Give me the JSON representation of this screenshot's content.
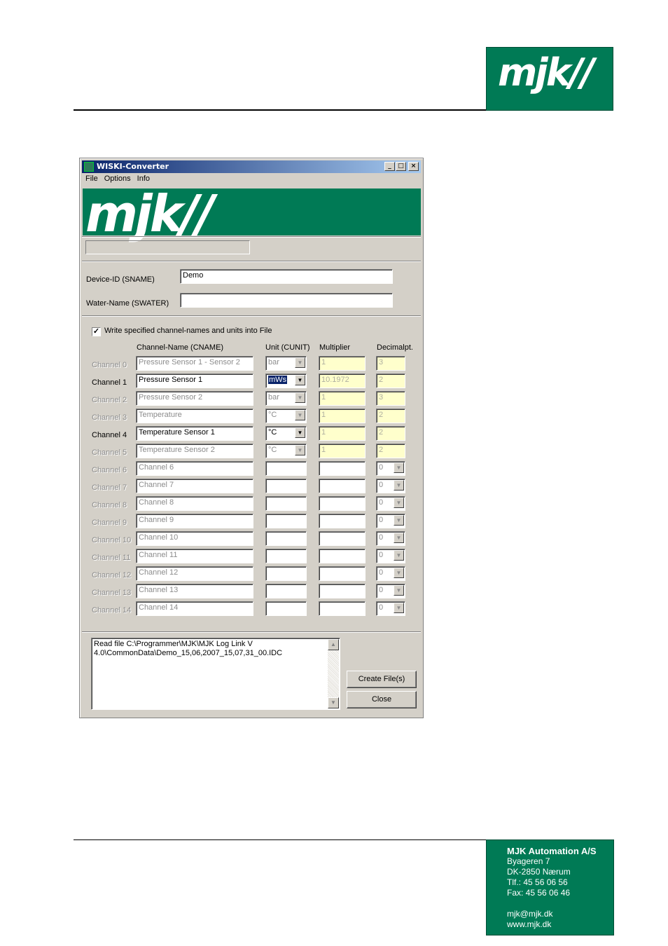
{
  "header": {
    "logo_text": "mjk//",
    "brand_color": "#007a55"
  },
  "window": {
    "title": "WISKI-Converter",
    "controls": {
      "minimize": "_",
      "maximize": "□",
      "close": "×"
    },
    "menu": [
      "File",
      "Options",
      "Info"
    ],
    "banner_logo": "mjk//",
    "device_id_label": "Device-ID (SNAME)",
    "device_id_value": "Demo",
    "water_name_label": "Water-Name (SWATER)",
    "water_name_value": "",
    "write_checkbox_label": "Write specified channel-names and units into File",
    "write_checkbox_checked": true,
    "columns": {
      "name": "Channel-Name (CNAME)",
      "unit": "Unit (CUNIT)",
      "multiplier": "Multiplier",
      "decimal": "Decimalpt."
    },
    "channels": [
      {
        "label": "Channel 0",
        "name": "Pressure Sensor 1 - Sensor 2",
        "unit": "bar",
        "multiplier": "1",
        "decimal": "3",
        "enabled": false,
        "has_unit_combo": true,
        "has_dec_combo": false
      },
      {
        "label": "Channel 1",
        "name": "Pressure Sensor 1",
        "unit": "mWs",
        "multiplier": "10.1972",
        "decimal": "2",
        "enabled": true,
        "has_unit_combo": true,
        "has_dec_combo": false
      },
      {
        "label": "Channel 2",
        "name": "Pressure Sensor 2",
        "unit": "bar",
        "multiplier": "1",
        "decimal": "3",
        "enabled": false,
        "has_unit_combo": true,
        "has_dec_combo": false
      },
      {
        "label": "Channel 3",
        "name": "Temperature",
        "unit": "°C",
        "multiplier": "1",
        "decimal": "2",
        "enabled": false,
        "has_unit_combo": true,
        "has_dec_combo": false
      },
      {
        "label": "Channel 4",
        "name": "Temperature Sensor 1",
        "unit": "°C",
        "multiplier": "1",
        "decimal": "2",
        "enabled": true,
        "has_unit_combo": true,
        "has_dec_combo": false
      },
      {
        "label": "Channel 5",
        "name": "Temperature Sensor 2",
        "unit": "°C",
        "multiplier": "1",
        "decimal": "2",
        "enabled": false,
        "has_unit_combo": true,
        "has_dec_combo": false
      },
      {
        "label": "Channel 6",
        "name": "Channel 6",
        "unit": "",
        "multiplier": "",
        "decimal": "0",
        "enabled": false,
        "has_unit_combo": false,
        "has_dec_combo": true
      },
      {
        "label": "Channel 7",
        "name": "Channel 7",
        "unit": "",
        "multiplier": "",
        "decimal": "0",
        "enabled": false,
        "has_unit_combo": false,
        "has_dec_combo": true
      },
      {
        "label": "Channel 8",
        "name": "Channel 8",
        "unit": "",
        "multiplier": "",
        "decimal": "0",
        "enabled": false,
        "has_unit_combo": false,
        "has_dec_combo": true
      },
      {
        "label": "Channel 9",
        "name": "Channel 9",
        "unit": "",
        "multiplier": "",
        "decimal": "0",
        "enabled": false,
        "has_unit_combo": false,
        "has_dec_combo": true
      },
      {
        "label": "Channel 10",
        "name": "Channel 10",
        "unit": "",
        "multiplier": "",
        "decimal": "0",
        "enabled": false,
        "has_unit_combo": false,
        "has_dec_combo": true
      },
      {
        "label": "Channel 11",
        "name": "Channel 11",
        "unit": "",
        "multiplier": "",
        "decimal": "0",
        "enabled": false,
        "has_unit_combo": false,
        "has_dec_combo": true
      },
      {
        "label": "Channel 12",
        "name": "Channel 12",
        "unit": "",
        "multiplier": "",
        "decimal": "0",
        "enabled": false,
        "has_unit_combo": false,
        "has_dec_combo": true
      },
      {
        "label": "Channel 13",
        "name": "Channel 13",
        "unit": "",
        "multiplier": "",
        "decimal": "0",
        "enabled": false,
        "has_unit_combo": false,
        "has_dec_combo": true
      },
      {
        "label": "Channel 14",
        "name": "Channel 14",
        "unit": "",
        "multiplier": "",
        "decimal": "0",
        "enabled": false,
        "has_unit_combo": false,
        "has_dec_combo": true
      }
    ],
    "log_text": "Read file C:\\Programmer\\MJK\\MJK Log Link V 4.0\\CommonData\\Demo_15,06,2007_15,07,31_00.IDC",
    "create_button": "Create File(s)",
    "close_button": "Close"
  },
  "footer": {
    "company": "MJK Automation A/S",
    "street": "Byageren 7",
    "city": "DK-2850 Nærum",
    "phone": "Tlf.:  45 56 06 56",
    "fax": "Fax:  45 56 06 46",
    "email": "mjk@mjk.dk",
    "web": "www.mjk.dk"
  }
}
